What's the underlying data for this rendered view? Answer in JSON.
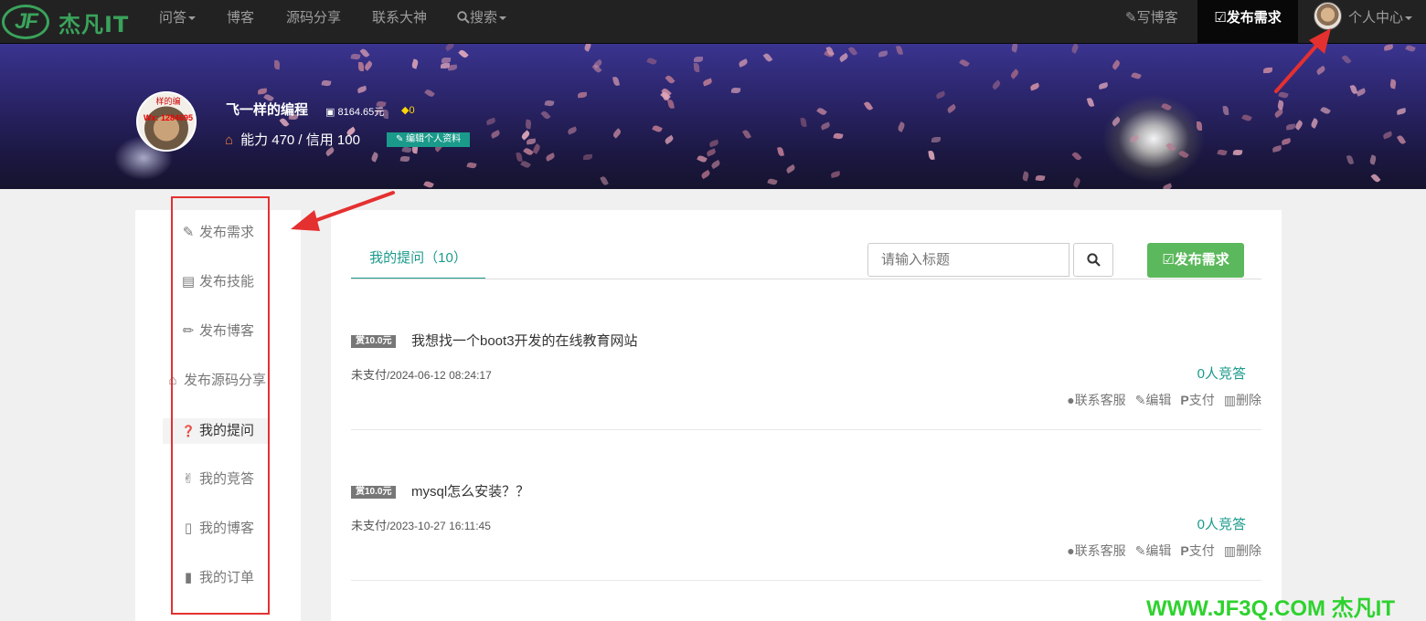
{
  "navbar": {
    "logo_mark": "JF",
    "logo_text": "杰凡IT",
    "items": [
      {
        "label": "问答",
        "dropdown": true
      },
      {
        "label": "博客",
        "dropdown": false
      },
      {
        "label": "源码分享",
        "dropdown": false
      },
      {
        "label": "联系大神",
        "dropdown": false
      },
      {
        "label": "搜索",
        "dropdown": true,
        "icon": "search-icon"
      }
    ],
    "write_blog": "写博客",
    "post_request": "发布需求",
    "user_center": "个人中心"
  },
  "profile": {
    "name": "飞一样的编程",
    "money": "8164.65元",
    "gems": "0",
    "stats": "能力 470 / 信用 100",
    "edit_label": "编辑个人资料",
    "avatar_top": "样的编",
    "avatar_tag": "Wx: 1284695"
  },
  "sidebar": {
    "items": [
      {
        "label": "发布需求",
        "icon": "edit-icon",
        "glyph": "✎"
      },
      {
        "label": "发布技能",
        "icon": "id-card-icon",
        "glyph": "▤"
      },
      {
        "label": "发布博客",
        "icon": "pencil-icon",
        "glyph": "✏"
      },
      {
        "label": "发布源码分享",
        "icon": "bank-icon",
        "glyph": "⌂"
      },
      {
        "label": "我的提问",
        "icon": "question-circle-icon",
        "glyph": "❓",
        "active": true
      },
      {
        "label": "我的竞答",
        "icon": "hand-peace-icon",
        "glyph": "✌"
      },
      {
        "label": "我的博客",
        "icon": "file-text-icon",
        "glyph": "▯"
      },
      {
        "label": "我的订单",
        "icon": "file-icon",
        "glyph": "▮"
      }
    ]
  },
  "main": {
    "tab_label": "我的提问（10）",
    "search_placeholder": "请输入标题",
    "post_button": "发布需求",
    "questions": [
      {
        "reward": "赏10.0元",
        "title": "我想找一个boot3开发的在线教育网站",
        "status": "未支付",
        "time": "/2024-06-12 08:24:17",
        "answers": "0人竞答"
      },
      {
        "reward": "赏10.0元",
        "title": "mysql怎么安装？？",
        "status": "未支付",
        "time": "/2023-10-27 16:11:45",
        "answers": "0人竞答"
      }
    ],
    "actions": {
      "contact": "联系客服",
      "edit": "编辑",
      "pay": "支付",
      "delete": "删除"
    }
  },
  "watermark": "WWW.JF3Q.COM 杰凡IT",
  "colors": {
    "navbar_bg": "#222222",
    "accent_teal": "#1a9a8a",
    "success_green": "#5cb85c",
    "highlight_red": "#e53030",
    "watermark_green": "#2ed22e"
  }
}
